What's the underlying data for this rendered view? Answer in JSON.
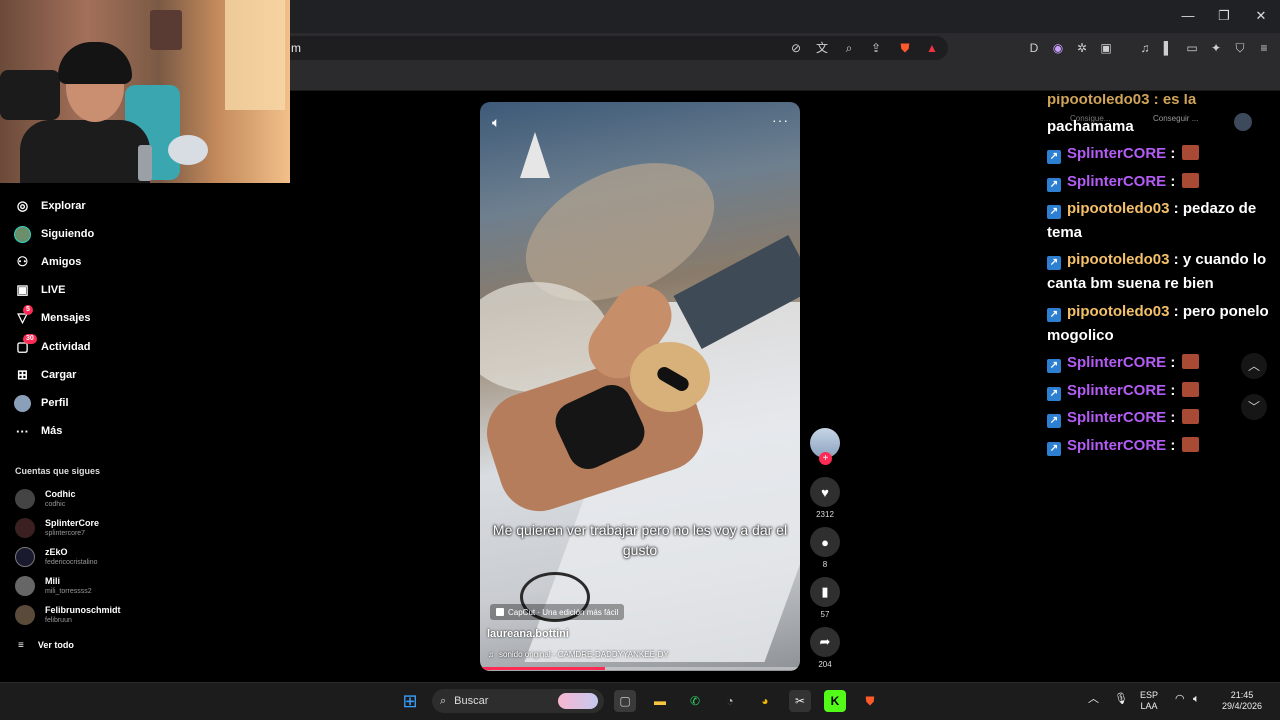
{
  "browser": {
    "address_text": "m",
    "window_controls": {
      "minimize": "—",
      "maximize": "❐",
      "close": "✕"
    }
  },
  "sidebar": {
    "nav": [
      {
        "label": "Explorar",
        "icon": "compass-icon"
      },
      {
        "label": "Siguiendo",
        "icon": "following-avatar-icon"
      },
      {
        "label": "Amigos",
        "icon": "friends-icon"
      },
      {
        "label": "LIVE",
        "icon": "live-tv-icon"
      },
      {
        "label": "Mensajes",
        "icon": "messages-icon",
        "badge": "5"
      },
      {
        "label": "Actividad",
        "icon": "activity-icon",
        "badge": "30"
      },
      {
        "label": "Cargar",
        "icon": "upload-icon"
      },
      {
        "label": "Perfil",
        "icon": "profile-avatar-icon"
      },
      {
        "label": "Más",
        "icon": "more-icon"
      }
    ],
    "following_title": "Cuentas que sigues",
    "following": [
      {
        "name": "Codhic",
        "handle": "codhic"
      },
      {
        "name": "SplinterCore",
        "handle": "splintercore7"
      },
      {
        "name": "zEkO",
        "handle": "federicocristalino"
      },
      {
        "name": "Mili",
        "handle": "mili_torressss2"
      },
      {
        "name": "Felibrunoschmidt",
        "handle": "felibruun"
      }
    ],
    "see_all": "Ver todo"
  },
  "video": {
    "caption": "Me quieren ver trabajar pero no les voy a dar el gusto",
    "capcut_label": "CapCut · Una edición más fácil",
    "author": "laureana.bottini",
    "sound": "sonido original - CAMDRE-DADDYYANKEE-DY",
    "progress": 0.39,
    "volume_icon": "volume-icon",
    "more_icon": "more-dots-icon"
  },
  "actions": {
    "likes": "2312",
    "comments": "8",
    "saves": "57",
    "shares": "204"
  },
  "chat": {
    "top_partial": "pipootoledo03 : es la",
    "overlay_labels": [
      "Consigue...",
      "Conseguir ..."
    ],
    "messages": [
      {
        "text": "pachamama",
        "user": "",
        "type": "continuation"
      },
      {
        "user": "SplinterCORE",
        "sep": " : ",
        "text": "",
        "type": "splinter"
      },
      {
        "user": "SplinterCORE",
        "sep": " : ",
        "text": "",
        "type": "splinter"
      },
      {
        "user": "pipootoledo03",
        "sep": " : ",
        "text": "pedazo de tema",
        "type": "pipo"
      },
      {
        "user": "pipootoledo03",
        "sep": " : ",
        "text": "y cuando lo canta bm suena re bien",
        "type": "pipo"
      },
      {
        "user": "pipootoledo03",
        "sep": " : ",
        "text": "pero ponelo mogolico",
        "type": "pipo"
      },
      {
        "user": "SplinterCORE",
        "sep": " : ",
        "text": "",
        "type": "splinter"
      },
      {
        "user": "SplinterCORE",
        "sep": " : ",
        "text": "",
        "type": "splinter"
      },
      {
        "user": "SplinterCORE",
        "sep": " : ",
        "text": "",
        "type": "splinter"
      },
      {
        "user": "SplinterCORE",
        "sep": " : ",
        "text": "",
        "type": "splinter"
      }
    ]
  },
  "taskbar": {
    "search_label": "Buscar",
    "lang_top": "ESP",
    "lang_bottom": "LAA",
    "time": "21:45",
    "date": "29/4/2026"
  },
  "colors": {
    "accent": "#fe2c55",
    "chat_splinter": "#b45cf5",
    "chat_pipo": "#f4c06a"
  }
}
